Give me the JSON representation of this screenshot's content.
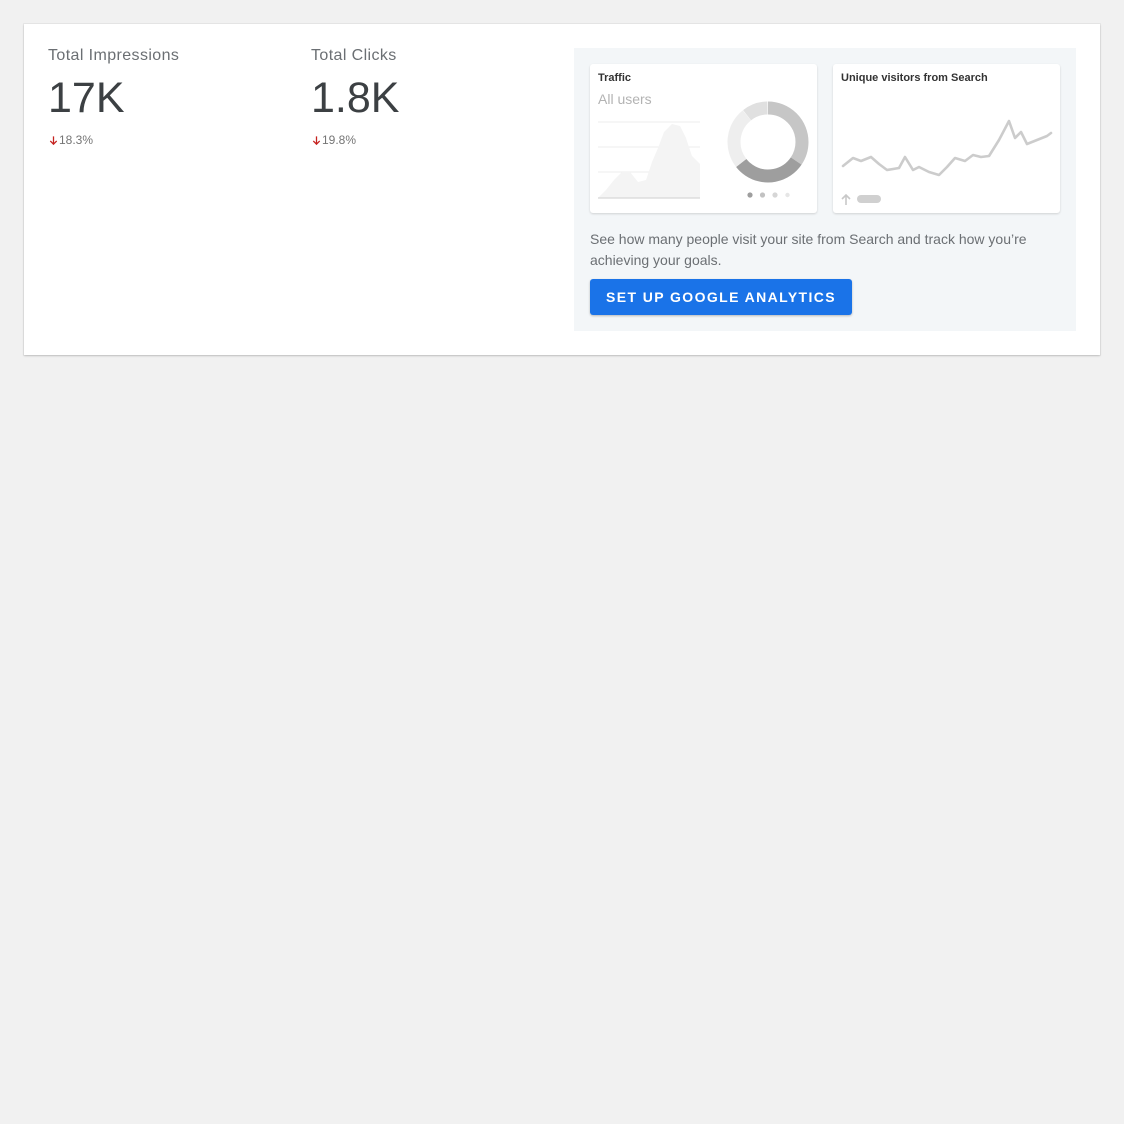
{
  "metrics": [
    {
      "label": "Total Impressions",
      "value": "17K",
      "change": "18.3%",
      "direction": "down"
    },
    {
      "label": "Total Clicks",
      "value": "1.8K",
      "change": "19.8%",
      "direction": "down"
    }
  ],
  "promo": {
    "traffic_card": {
      "title": "Traffic",
      "subtitle": "All users"
    },
    "visitors_card": {
      "title": "Unique visitors from Search"
    },
    "description": "See how many people visit your site from Search and track how you’re achieving your goals.",
    "button_label": "SET UP GOOGLE ANALYTICS"
  },
  "colors": {
    "accent": "#1a73e8",
    "negative": "#c5221f",
    "background": "#f1f1f1",
    "promo_background": "#f3f6f8"
  }
}
